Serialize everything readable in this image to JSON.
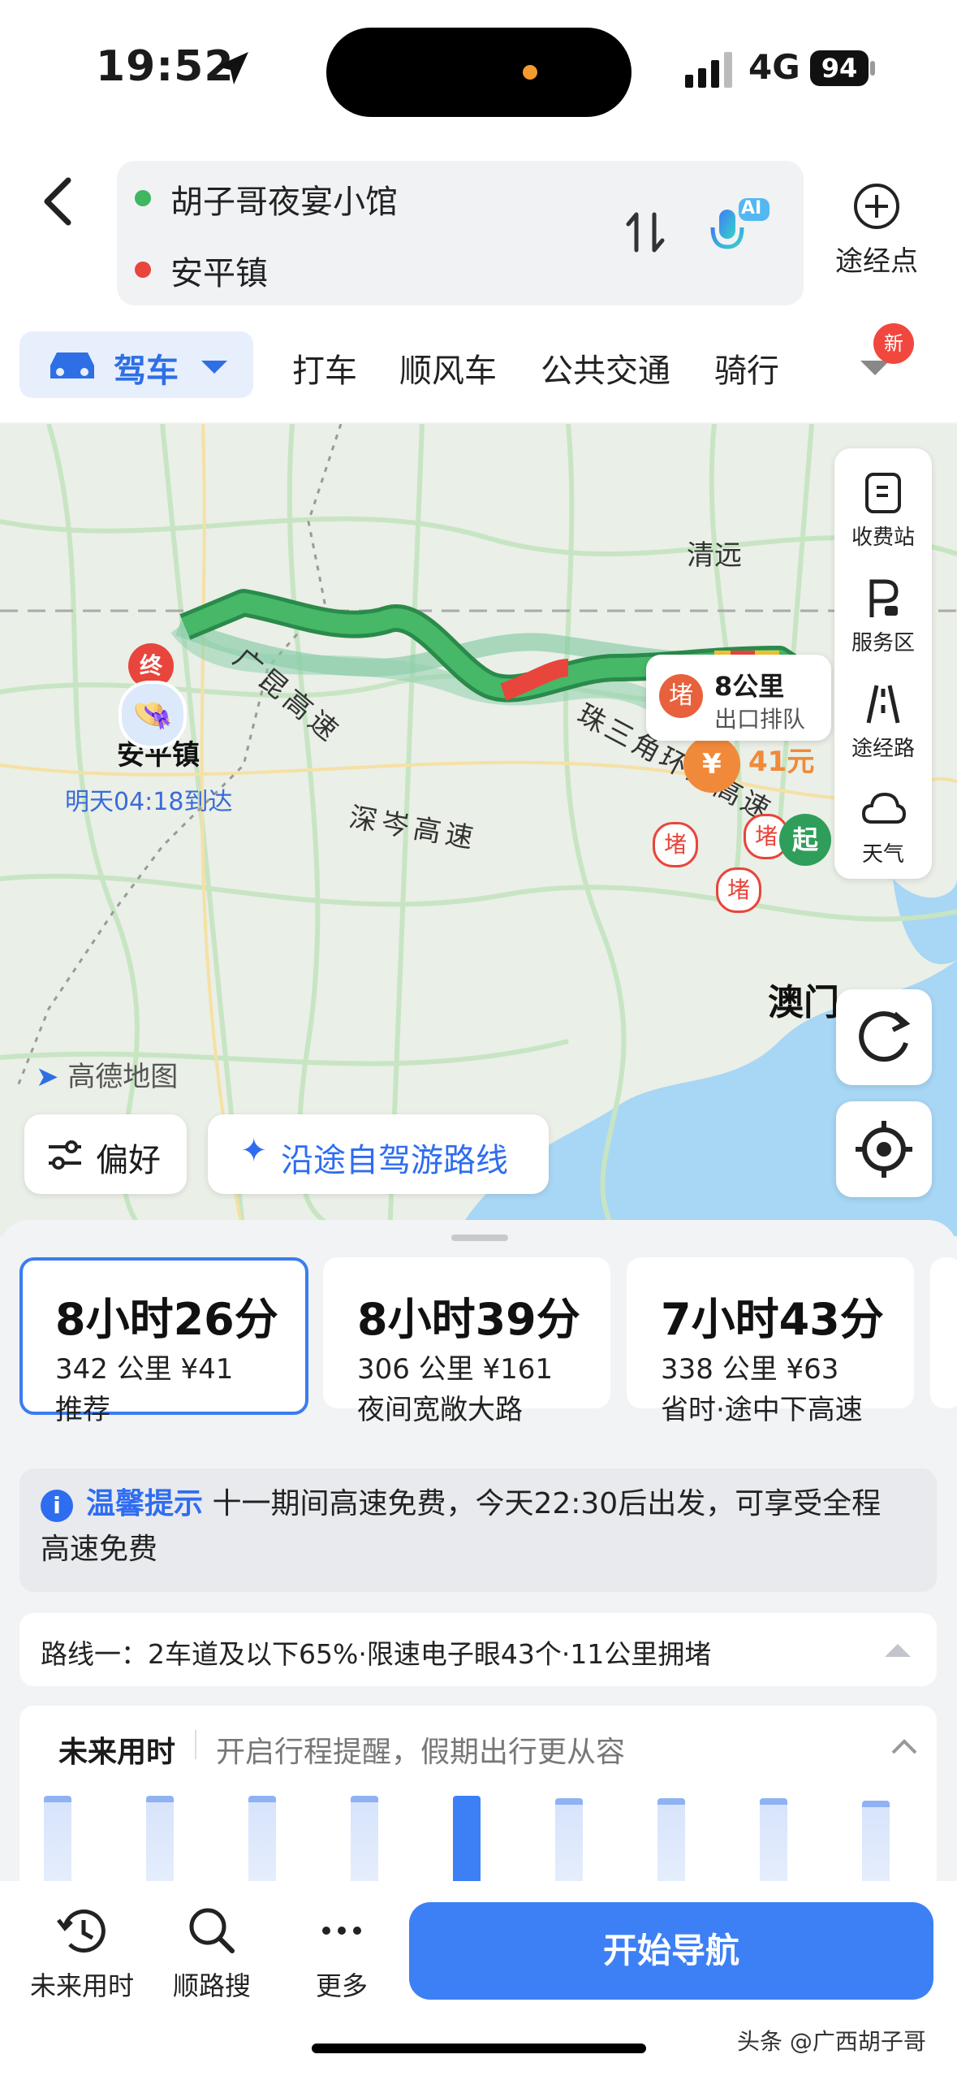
{
  "status_bar": {
    "time": "19:52",
    "network": "4G",
    "battery": "94"
  },
  "header": {
    "origin": "胡子哥夜宴小馆",
    "destination": "安平镇",
    "via_label": "途经点",
    "ai_badge": "AI"
  },
  "tabs": {
    "drive": "驾车",
    "items": [
      "打车",
      "顺风车",
      "公共交通",
      "骑行"
    ],
    "new_badge": "新"
  },
  "map": {
    "labels": {
      "qingyuan": "清远",
      "anping": "安平镇",
      "macau": "澳门",
      "guangkun": "广昆高速",
      "shencen": "深岑高速",
      "pearl_ring": "珠三角环线高速"
    },
    "eta": "明天04:18到达",
    "jam_icon": "堵",
    "start_icon": "起",
    "end_icon": "终",
    "jam_bubble": {
      "distance": "8公里",
      "desc": "出口排队"
    },
    "toll_label": "41元",
    "side_panel": [
      "收费站",
      "服务区",
      "途经路",
      "天气"
    ],
    "brand": "高德地图",
    "pref_button": "偏好",
    "selfdrive_button": "沿途自驾游路线"
  },
  "routes": [
    {
      "time": "8小时26分",
      "distance": "342 公里",
      "cost": "¥41",
      "tag": "推荐",
      "selected": true
    },
    {
      "time": "8小时39分",
      "distance": "306 公里",
      "cost": "¥161",
      "tag": "夜间宽敞大路",
      "selected": false
    },
    {
      "time": "7小时43分",
      "distance": "338 公里",
      "cost": "¥63",
      "tag": "省时·途中下高速",
      "selected": false
    }
  ],
  "tip": {
    "title": "温馨提示",
    "text1": "十一期间高速免费，今天22:30后出发，可享受全程",
    "text2": "高速免费"
  },
  "route_info": "路线一：2车道及以下65%·限速电子眼43个·11公里拥堵",
  "future": {
    "title": "未来用时",
    "hint": "开启行程提醒，假期出行更从容",
    "bars": [
      0.92,
      0.92,
      0.92,
      0.92,
      0.92,
      0.9,
      0.9,
      0.9,
      0.88
    ],
    "selected_bar": 4
  },
  "bottom_bar": {
    "items": [
      "未来用时",
      "顺路搜",
      "更多"
    ],
    "start": "开始导航"
  },
  "watermark": "头条 @广西胡子哥",
  "colors": {
    "accent": "#3d80f5",
    "route_green": "#3fae5f",
    "jam_red": "#e8453c"
  }
}
